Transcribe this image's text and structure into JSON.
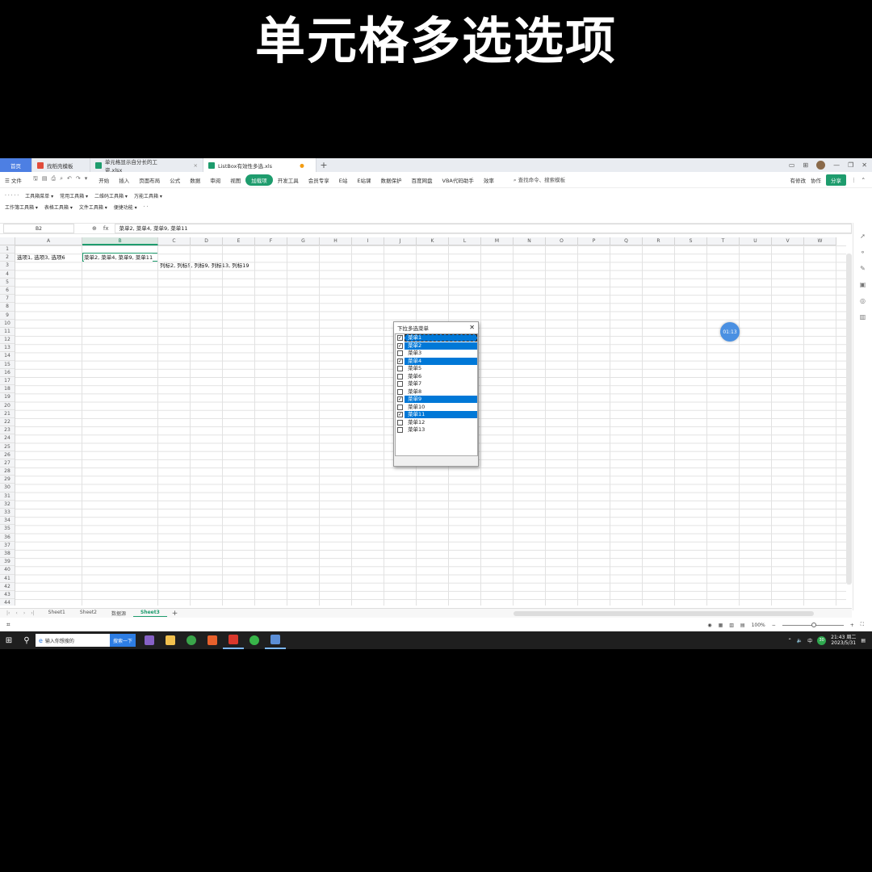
{
  "headline": "单元格多选选项",
  "tabs": [
    {
      "label": "首页",
      "kind": "home"
    },
    {
      "label": "找稻壳模板",
      "color": "#e04b3a"
    },
    {
      "label": "单元格显示自分长的工资.xlsx",
      "color": "#1e9c6d"
    },
    {
      "label": "ListBox有效性多选.xls",
      "color": "#1e9c6d"
    }
  ],
  "new_tab": "+",
  "menu": {
    "file": "☰ 文件",
    "items": [
      "开始",
      "插入",
      "页面布局",
      "公式",
      "数据",
      "审阅",
      "视图",
      "加载项",
      "开发工具",
      "会员专享",
      "E站",
      "E站课",
      "数据保护",
      "百度网盘",
      "VBA代码助手",
      "效率"
    ],
    "active_index": 7,
    "search": "查找命令、搜索模板",
    "right": [
      "有修改",
      "协作"
    ],
    "share": "分享"
  },
  "toolrows": [
    [
      "· · · · ·",
      "工具箱菜单 ▾",
      "常用工具箱 ▾",
      "二维码工具箱 ▾",
      "万能工具箱 ▾"
    ],
    [
      "工作簿工具箱 ▾",
      "表格工具箱 ▾",
      "文件工具箱 ▾",
      "便捷功能 ▾",
      "· ·"
    ]
  ],
  "namebox": "B2",
  "fx": "fx",
  "formula_value": "菜单2, 菜单4, 菜单9, 菜单11",
  "columns": [
    "A",
    "B",
    "C",
    "D",
    "E",
    "F",
    "G",
    "H",
    "I",
    "J",
    "K",
    "L",
    "M",
    "N",
    "O",
    "P",
    "Q",
    "R",
    "S",
    "T",
    "U",
    "V",
    "W"
  ],
  "selected_column": "B",
  "rows": [
    "1",
    "2",
    "3",
    "4",
    "5",
    "6",
    "7",
    "8",
    "9",
    "10",
    "11",
    "12",
    "13",
    "14",
    "15",
    "16",
    "17",
    "18",
    "19",
    "20",
    "21",
    "22",
    "23",
    "24",
    "25",
    "26",
    "27",
    "28",
    "29",
    "30",
    "31",
    "32",
    "33",
    "34",
    "35",
    "36",
    "37",
    "38",
    "39",
    "40",
    "41",
    "42",
    "43",
    "44"
  ],
  "cells": {
    "a2": "选项1, 选项3, 选项6",
    "b2": "菜单2, 菜单4, 菜单9, 菜单11",
    "c3": "列标2, 列标5, 列标9, 列标13, 列标19"
  },
  "listbox": {
    "title": "下拉多选菜单",
    "close": "✕",
    "items": [
      {
        "label": "菜单1",
        "checked": true,
        "selected": true,
        "focus": true
      },
      {
        "label": "菜单2",
        "checked": true,
        "selected": true
      },
      {
        "label": "菜单3",
        "checked": false,
        "selected": false
      },
      {
        "label": "菜单4",
        "checked": true,
        "selected": true
      },
      {
        "label": "菜单5",
        "checked": false,
        "selected": false
      },
      {
        "label": "菜单6",
        "checked": false,
        "selected": false
      },
      {
        "label": "菜单7",
        "checked": false,
        "selected": false
      },
      {
        "label": "菜单8",
        "checked": false,
        "selected": false
      },
      {
        "label": "菜单9",
        "checked": true,
        "selected": true
      },
      {
        "label": "菜单10",
        "checked": false,
        "selected": false
      },
      {
        "label": "菜单11",
        "checked": true,
        "selected": true
      },
      {
        "label": "菜单12",
        "checked": false,
        "selected": false
      },
      {
        "label": "菜单13",
        "checked": false,
        "selected": false
      }
    ]
  },
  "timer": "01:13",
  "sheets": [
    "Sheet1",
    "Sheet2",
    "数据源",
    "Sheet3"
  ],
  "active_sheet": "Sheet3",
  "zoom": "100%",
  "taskbar": {
    "search_placeholder": "输入你想搜的",
    "search_button": "搜索一下",
    "ime": "中",
    "badge": "30",
    "time": "21:43 周二",
    "date": "2023/5/31"
  },
  "colors": {
    "accent": "#1e9c6d",
    "selection": "#0078d7",
    "home_tab": "#4d7fe3"
  }
}
